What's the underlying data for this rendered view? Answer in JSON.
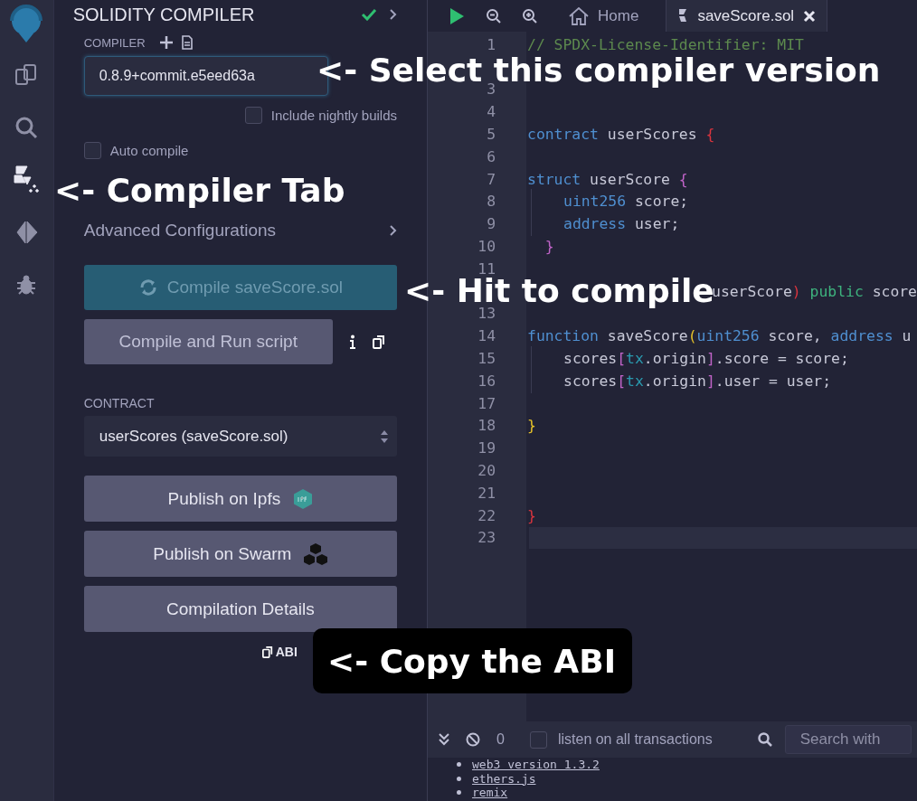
{
  "icon_bar": [
    {
      "kind": "files",
      "selected": false
    },
    {
      "kind": "search",
      "selected": false
    },
    {
      "kind": "compiler",
      "selected": true
    },
    {
      "kind": "deploy",
      "selected": false
    },
    {
      "kind": "debug",
      "selected": false
    }
  ],
  "panel": {
    "title": "SOLIDITY COMPILER",
    "compiled": true,
    "compiler_label": "COMPILER",
    "version": "0.8.9+commit.e5eed63a",
    "nightly": {
      "label": "Include nightly builds",
      "checked": false
    },
    "auto_compile": {
      "label": "Auto compile",
      "checked": false
    },
    "advanced": "Advanced Configurations",
    "compile_button": "Compile saveScore.sol",
    "run_script_button": "Compile and Run script",
    "contract_label": "CONTRACT",
    "contract": "userScores (saveScore.sol)",
    "buttons": [
      {
        "label": "Publish on Ipfs",
        "kind": "ipfs"
      },
      {
        "label": "Publish on Swarm",
        "kind": "swarm"
      },
      {
        "label": "Compilation Details",
        "kind": "plain"
      }
    ],
    "abi": "ABI"
  },
  "editor": {
    "tabs": [
      {
        "label": "Home",
        "kind": "home",
        "selected": false
      },
      {
        "label": "saveScore.sol",
        "kind": "file",
        "selected": true
      }
    ],
    "lines": [
      {
        "number": "1",
        "active": false,
        "tokens": [
          {
            "t": "// SPDX-License-Identifier: MIT",
            "kind": "comment"
          }
        ]
      },
      {
        "active": false
      },
      {
        "number": "3",
        "active": false
      },
      {
        "number": "4",
        "active": false
      },
      {
        "number": "5",
        "active": false,
        "tokens": [
          {
            "t": "contract",
            "kind": "kw"
          },
          {
            "t": " userScores ",
            "kind": "id"
          },
          {
            "t": "{",
            "kind": "red"
          }
        ]
      },
      {
        "number": "6",
        "active": false
      },
      {
        "number": "7",
        "active": false,
        "tokens": [
          {
            "t": "struct",
            "kind": "kw"
          },
          {
            "t": " userScore ",
            "kind": "id"
          },
          {
            "t": "{",
            "kind": "pink"
          }
        ]
      },
      {
        "number": "8",
        "active": false,
        "indented": true,
        "tokens": [
          {
            "t": "uint256",
            "kind": "kw"
          },
          {
            "t": " score;",
            "kind": "id"
          }
        ]
      },
      {
        "number": "9",
        "active": false,
        "indented": true,
        "tokens": [
          {
            "t": "address",
            "kind": "kw"
          },
          {
            "t": " user;",
            "kind": "id"
          }
        ]
      },
      {
        "number": "10",
        "active": false,
        "tokens": [
          {
            "t": "  }",
            "kind": "pink"
          }
        ]
      },
      {
        "number": "11",
        "active": false
      },
      {
        "active": false,
        "tokens": [
          {
            "t": "userScore",
            "kind": "id"
          },
          {
            "t": ")",
            "kind": "red"
          },
          {
            "t": " public",
            "kind": "green"
          },
          {
            "t": " score",
            "kind": "id"
          }
        ]
      },
      {
        "number": "13",
        "active": false
      },
      {
        "number": "14",
        "active": false,
        "tokens": [
          {
            "t": "function",
            "kind": "kw"
          },
          {
            "t": " saveScore",
            "kind": "id"
          },
          {
            "t": "(",
            "kind": "yellow"
          },
          {
            "t": "uint256",
            "kind": "kw"
          },
          {
            "t": " score, ",
            "kind": "id"
          },
          {
            "t": "address",
            "kind": "kw"
          },
          {
            "t": " u",
            "kind": "id"
          }
        ]
      },
      {
        "number": "15",
        "active": false,
        "indented": true,
        "tokens": [
          {
            "t": "scores",
            "kind": "id"
          },
          {
            "t": "[",
            "kind": "pink"
          },
          {
            "t": "tx",
            "kind": "teal"
          },
          {
            "t": ".origin",
            "kind": "id"
          },
          {
            "t": "]",
            "kind": "pink"
          },
          {
            "t": ".score = score;",
            "kind": "id"
          }
        ]
      },
      {
        "number": "16",
        "active": false,
        "indented": true,
        "tokens": [
          {
            "t": "scores",
            "kind": "id"
          },
          {
            "t": "[",
            "kind": "pink"
          },
          {
            "t": "tx",
            "kind": "teal"
          },
          {
            "t": ".origin",
            "kind": "id"
          },
          {
            "t": "]",
            "kind": "pink"
          },
          {
            "t": ".user = user;",
            "kind": "id"
          }
        ]
      },
      {
        "number": "17",
        "active": false
      },
      {
        "number": "18",
        "active": false,
        "tokens": [
          {
            "t": "}",
            "kind": "yellow"
          }
        ]
      },
      {
        "number": "19",
        "active": false
      },
      {
        "number": "20",
        "active": false
      },
      {
        "number": "21",
        "active": false
      },
      {
        "number": "22",
        "active": false,
        "tokens": [
          {
            "t": "}",
            "kind": "red"
          }
        ]
      },
      {
        "number": "23",
        "active": true
      }
    ]
  },
  "terminal": {
    "count": "0",
    "listen": {
      "label": "listen on all transactions",
      "checked": false
    },
    "search_placeholder": "Search with",
    "log_links": [
      "web3 version 1.3.2",
      "ethers.js",
      "remix"
    ]
  },
  "annotations": [
    {
      "text": "<- Select this compiler version",
      "kind": "plain"
    },
    {
      "text": "<- Compiler Tab",
      "kind": "plain"
    },
    {
      "text": "<- Hit to compile",
      "kind": "plain"
    },
    {
      "text": "<- Copy the ABI",
      "kind": "boxed"
    }
  ]
}
